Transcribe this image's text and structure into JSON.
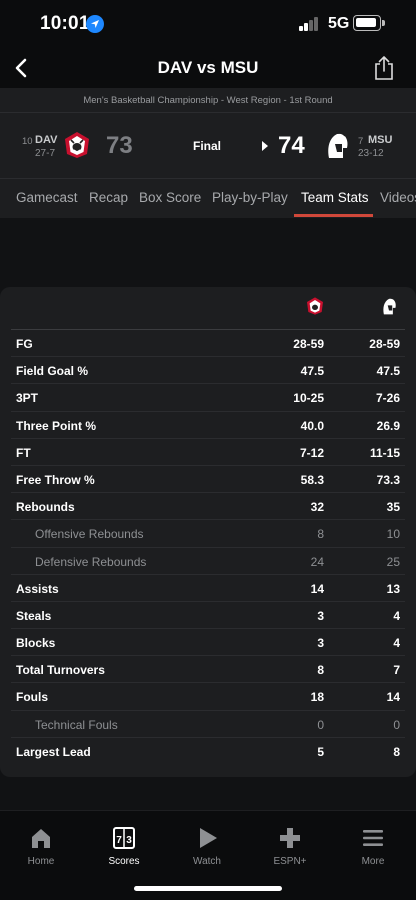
{
  "status_bar": {
    "time": "10:01",
    "network": "5G"
  },
  "nav": {
    "title": "DAV vs MSU"
  },
  "game": {
    "subtitle": "Men's Basketball Championship - West Region - 1st Round",
    "status": "Final",
    "away": {
      "rank": "10",
      "abbr": "DAV",
      "record": "27-7",
      "score": "73"
    },
    "home": {
      "rank": "7",
      "abbr": "MSU",
      "record": "23-12",
      "score": "74"
    }
  },
  "tabs": [
    "Gamecast",
    "Recap",
    "Box Score",
    "Play-by-Play",
    "Team Stats",
    "Videos"
  ],
  "active_tab": "Team Stats",
  "stats": [
    {
      "label": "FG",
      "away": "28-59",
      "home": "28-59",
      "sub": false
    },
    {
      "label": "Field Goal %",
      "away": "47.5",
      "home": "47.5",
      "sub": false
    },
    {
      "label": "3PT",
      "away": "10-25",
      "home": "7-26",
      "sub": false
    },
    {
      "label": "Three Point %",
      "away": "40.0",
      "home": "26.9",
      "sub": false
    },
    {
      "label": "FT",
      "away": "7-12",
      "home": "11-15",
      "sub": false
    },
    {
      "label": "Free Throw %",
      "away": "58.3",
      "home": "73.3",
      "sub": false
    },
    {
      "label": "Rebounds",
      "away": "32",
      "home": "35",
      "sub": false
    },
    {
      "label": "Offensive Rebounds",
      "away": "8",
      "home": "10",
      "sub": true
    },
    {
      "label": "Defensive Rebounds",
      "away": "24",
      "home": "25",
      "sub": true
    },
    {
      "label": "Assists",
      "away": "14",
      "home": "13",
      "sub": false
    },
    {
      "label": "Steals",
      "away": "3",
      "home": "4",
      "sub": false
    },
    {
      "label": "Blocks",
      "away": "3",
      "home": "4",
      "sub": false
    },
    {
      "label": "Total Turnovers",
      "away": "8",
      "home": "7",
      "sub": false
    },
    {
      "label": "Fouls",
      "away": "18",
      "home": "14",
      "sub": false
    },
    {
      "label": "Technical Fouls",
      "away": "0",
      "home": "0",
      "sub": true
    },
    {
      "label": "Largest Lead",
      "away": "5",
      "home": "8",
      "sub": false
    }
  ],
  "bottom_nav": [
    {
      "label": "Home",
      "icon": "home-icon"
    },
    {
      "label": "Scores",
      "icon": "scores-icon",
      "active": true
    },
    {
      "label": "Watch",
      "icon": "play-icon"
    },
    {
      "label": "ESPN+",
      "icon": "plus-icon"
    },
    {
      "label": "More",
      "icon": "menu-icon"
    }
  ],
  "colors": {
    "accent": "#d0483a",
    "background": "#111214",
    "card": "#1d1e20"
  }
}
